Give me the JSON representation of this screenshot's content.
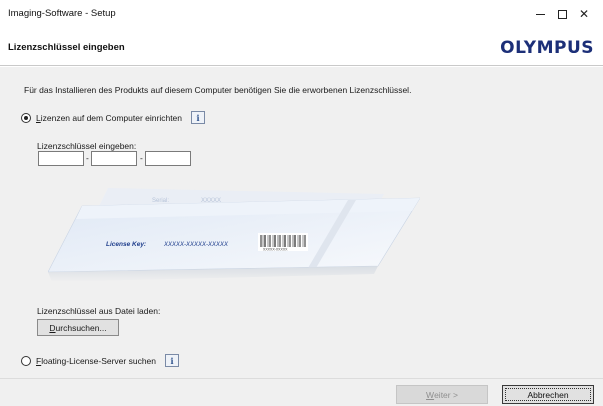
{
  "window": {
    "title": "Imaging-Software - Setup",
    "minimize": "–",
    "maximize": "□",
    "close": "✕"
  },
  "header": {
    "heading": "Lizenzschlüssel eingeben",
    "logo": "OLYMPUS"
  },
  "intro": "Für das Installieren des Produkts auf diesem Computer benötigen Sie die erworbenen Lizenzschlüssel.",
  "option_local": {
    "label": "Lizenzen auf dem Computer einrichten",
    "selected": true,
    "info": "i"
  },
  "license_key": {
    "label": "Lizenzschlüssel eingeben:",
    "fields": [
      "",
      "",
      ""
    ],
    "separator": "-"
  },
  "card": {
    "label": "License Key:",
    "value": "XXXXX-XXXXX-XXXXX",
    "barcode_text": "XXXXX-XXXXX",
    "back_text": "XXXXX",
    "back_label": "Serial:"
  },
  "file": {
    "label": "Lizenzschlüssel aus Datei laden:",
    "browse": "Durchsuchen..."
  },
  "option_floating": {
    "label": "Floating-License-Server suchen",
    "selected": false,
    "info": "i"
  },
  "buttons": {
    "next": "Weiter >",
    "cancel": "Abbrechen"
  },
  "colors": {
    "logo": "#1c2f78",
    "card_text": "#1f3e8c",
    "dialog_bg": "#f0f0f0"
  }
}
